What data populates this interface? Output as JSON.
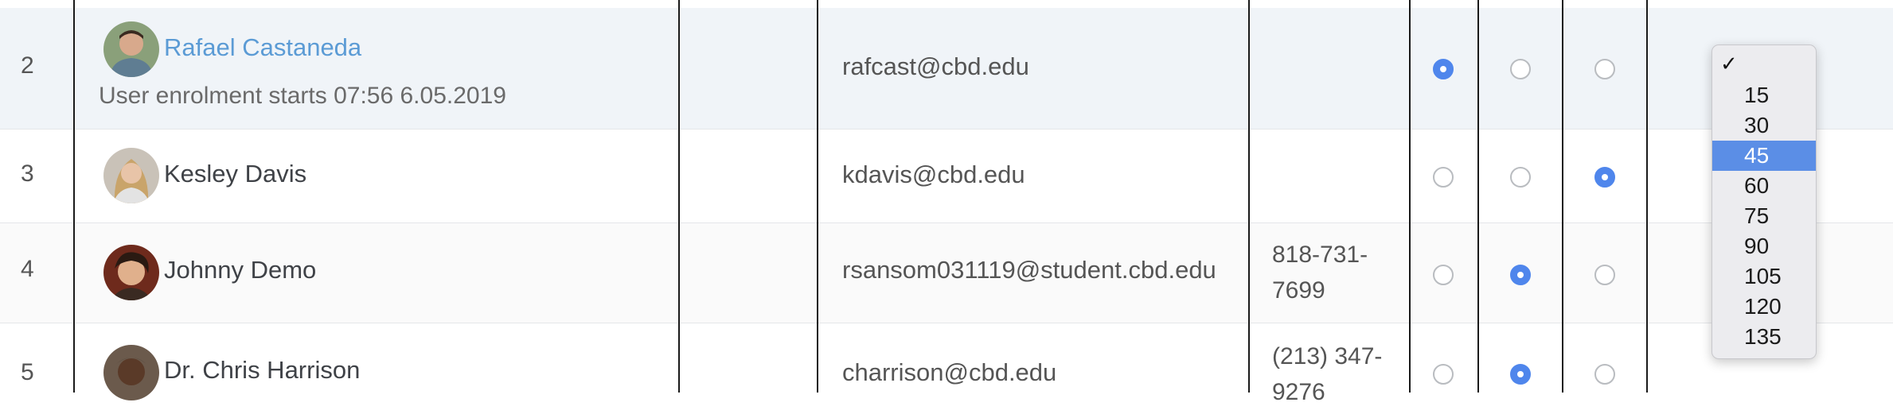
{
  "rows": [
    {
      "number": "2",
      "name": "Rafael Castaneda",
      "name_is_link": true,
      "enrolment_note": "User enrolment starts 07:56 6.05.2019",
      "email": "rafcast@cbd.edu",
      "phone": "",
      "selected_radio": 1
    },
    {
      "number": "3",
      "name": "Kesley Davis",
      "name_is_link": false,
      "enrolment_note": "",
      "email": "kdavis@cbd.edu",
      "phone": "",
      "selected_radio": 3
    },
    {
      "number": "4",
      "name": "Johnny Demo",
      "name_is_link": false,
      "enrolment_note": "",
      "email": "rsansom031119@student.cbd.edu",
      "phone": "818-731-7699",
      "selected_radio": 2
    },
    {
      "number": "5",
      "name": "Dr. Chris Harrison",
      "name_is_link": false,
      "enrolment_note": "",
      "email": "charrison@cbd.edu",
      "phone": "(213) 347-9276",
      "selected_radio": 2
    }
  ],
  "dropdown": {
    "check_mark": "✓",
    "options": [
      "15",
      "30",
      "45",
      "60",
      "75",
      "90",
      "105",
      "120",
      "135"
    ],
    "selected": "45",
    "highlight_color": "#5b8ee6"
  },
  "colors": {
    "link": "#5b9bd5",
    "radio_selected": "#4f86ec",
    "row_highlight": "#f0f4f8"
  }
}
